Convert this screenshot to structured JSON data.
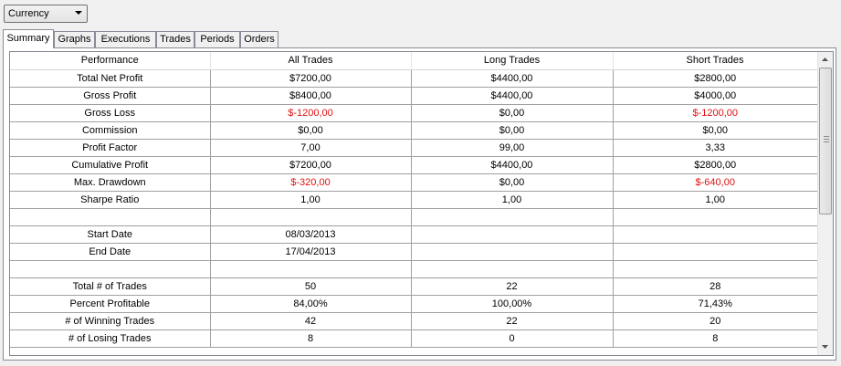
{
  "toolbar": {
    "currency_select": "Currency"
  },
  "tabs": [
    "Summary",
    "Graphs",
    "Executions",
    "Trades",
    "Periods",
    "Orders"
  ],
  "colors": {
    "negative": "#e01010"
  },
  "table": {
    "headers": [
      "Performance",
      "All Trades",
      "Long Trades",
      "Short Trades"
    ],
    "rows": [
      [
        "Total Net Profit",
        "$7200,00",
        "$4400,00",
        "$2800,00"
      ],
      [
        "Gross Profit",
        "$8400,00",
        "$4400,00",
        "$4000,00"
      ],
      [
        "Gross Loss",
        "$-1200,00",
        "$0,00",
        "$-1200,00"
      ],
      [
        "Commission",
        "$0,00",
        "$0,00",
        "$0,00"
      ],
      [
        "Profit Factor",
        "7,00",
        "99,00",
        "3,33"
      ],
      [
        "Cumulative Profit",
        "$7200,00",
        "$4400,00",
        "$2800,00"
      ],
      [
        "Max. Drawdown",
        "$-320,00",
        "$0,00",
        "$-640,00"
      ],
      [
        "Sharpe Ratio",
        "1,00",
        "1,00",
        "1,00"
      ],
      [
        "",
        "",
        "",
        ""
      ],
      [
        "Start Date",
        "08/03/2013",
        "",
        ""
      ],
      [
        "End Date",
        "17/04/2013",
        "",
        ""
      ],
      [
        "",
        "",
        "",
        ""
      ],
      [
        "Total # of Trades",
        "50",
        "22",
        "28"
      ],
      [
        "Percent Profitable",
        "84,00%",
        "100,00%",
        "71,43%"
      ],
      [
        "# of Winning Trades",
        "42",
        "22",
        "20"
      ],
      [
        "# of Losing Trades",
        "8",
        "0",
        "8"
      ]
    ]
  }
}
